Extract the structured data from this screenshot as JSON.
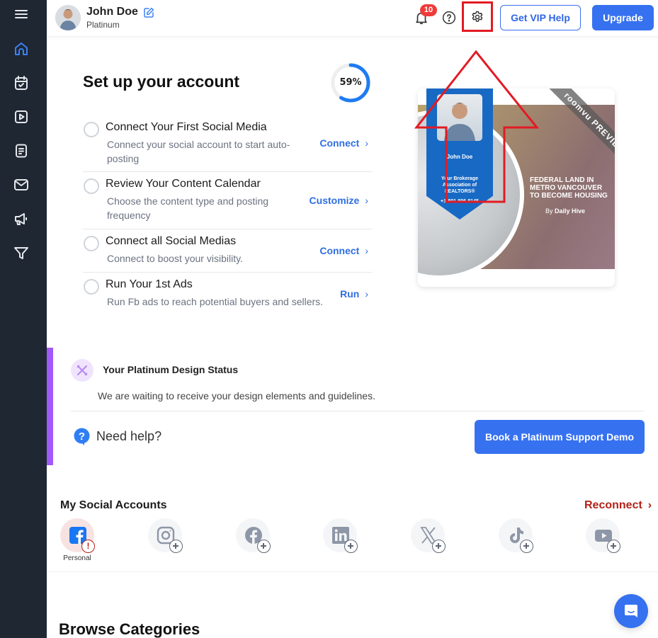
{
  "sidebar": {
    "menu_icon": "hamburger-menu-icon",
    "items": [
      {
        "name": "home",
        "icon": "home-icon",
        "active": true
      },
      {
        "name": "calendar",
        "icon": "calendar-check-icon",
        "active": false
      },
      {
        "name": "video",
        "icon": "play-square-icon",
        "active": false
      },
      {
        "name": "content",
        "icon": "document-icon",
        "active": false
      },
      {
        "name": "email",
        "icon": "mail-icon",
        "active": false
      },
      {
        "name": "ads",
        "icon": "megaphone-icon",
        "active": false
      },
      {
        "name": "funnel",
        "icon": "filter-icon",
        "active": false
      }
    ]
  },
  "header": {
    "user_name": "John Doe",
    "user_plan": "Platinum",
    "notification_count": "10",
    "vip_label": "Get VIP Help",
    "upgrade_label": "Upgrade"
  },
  "setup": {
    "title": "Set up your account",
    "progress_percent": 59,
    "progress_label": "59%",
    "tasks": [
      {
        "title": "Connect Your First Social Media",
        "description": "Connect your social account to start auto-posting",
        "action": "Connect",
        "done": false
      },
      {
        "title": "Review Your Content Calendar",
        "description": "Choose the content type and posting frequency",
        "action": "Customize",
        "done": false
      },
      {
        "title": "Connect all Social Medias",
        "description": "Connect to boost your visibility.",
        "action": "Connect",
        "done": false
      },
      {
        "title": "Run Your 1st Ads",
        "description": "Run Fb ads to reach potential buyers and sellers.",
        "action": "Run",
        "done": false
      }
    ]
  },
  "preview": {
    "ribbon": "roomvu PREVIEW",
    "agent_name": "John Doe",
    "agent_org_1": "Your Brokerage",
    "agent_org_2": "Association of",
    "agent_org_3": "REALTORS®",
    "agent_phone": "+1-801-896-8145",
    "headline_1": "FEDERAL LAND IN",
    "headline_2": "METRO VANCOUVER",
    "headline_3": "TO BECOME HOUSING",
    "byline_prefix": "By",
    "byline_source": "Daily Hive"
  },
  "design_status": {
    "title": "Your Platinum Design Status",
    "description": "We are waiting to receive your design elements and guidelines.",
    "help_label": "Need help?",
    "book_label": "Book a Platinum Support Demo",
    "accent": "#a259f7"
  },
  "social": {
    "title": "My Social Accounts",
    "reconnect_label": "Reconnect",
    "accounts": [
      {
        "platform": "facebook",
        "icon": "facebook-icon",
        "status": "error",
        "label": "Personal"
      },
      {
        "platform": "instagram",
        "icon": "instagram-icon",
        "status": "add"
      },
      {
        "platform": "facebook-page",
        "icon": "facebook-circle-icon",
        "status": "add"
      },
      {
        "platform": "linkedin",
        "icon": "linkedin-icon",
        "status": "add"
      },
      {
        "platform": "x",
        "icon": "x-icon",
        "status": "add"
      },
      {
        "platform": "tiktok",
        "icon": "tiktok-icon",
        "status": "add"
      },
      {
        "platform": "youtube",
        "icon": "youtube-icon",
        "status": "add"
      }
    ]
  },
  "browse": {
    "title": "Browse Categories"
  },
  "colors": {
    "primary": "#3671f0",
    "sidebar_bg": "#1f2733",
    "danger": "#b42318",
    "annotation": "#e21b23"
  }
}
